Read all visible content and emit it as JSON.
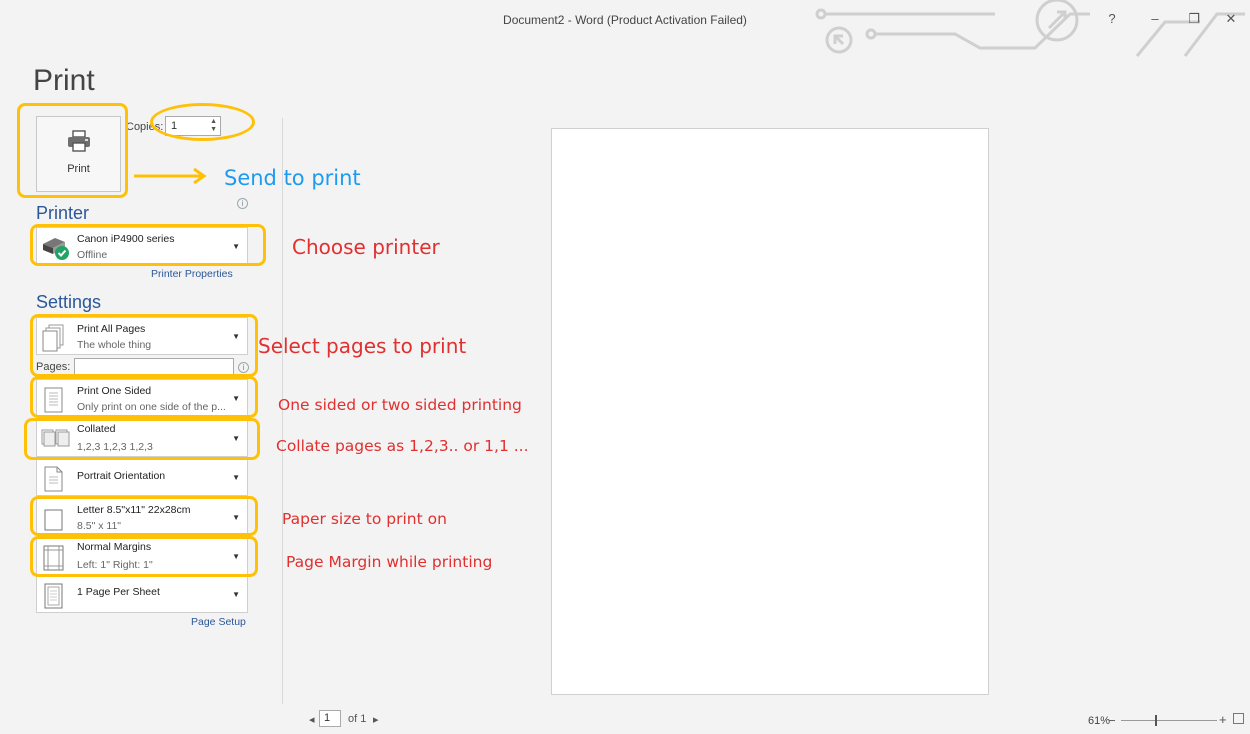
{
  "window": {
    "title": "Document2 - Word (Product Activation Failed)",
    "help": "?",
    "minimize": "–",
    "restore": "❐",
    "close": "✕"
  },
  "backstage": {
    "heading": "Print",
    "print_button_label": "Print",
    "copies_label": "Copies:",
    "copies_value": "1"
  },
  "printer": {
    "section_title": "Printer",
    "name": "Canon iP4900 series",
    "status": "Offline",
    "properties_link": "Printer Properties"
  },
  "settings": {
    "section_title": "Settings",
    "pages_label": "Pages:",
    "pages_value": "",
    "items": [
      {
        "title": "Print All Pages",
        "subtitle": "The whole thing",
        "icon": "pages-icon"
      },
      {
        "title": "Print One Sided",
        "subtitle": "Only print on one side of the p...",
        "icon": "one-sided-icon"
      },
      {
        "title": "Collated",
        "subtitle": "1,2,3    1,2,3    1,2,3",
        "icon": "collated-icon"
      },
      {
        "title": "Portrait Orientation",
        "subtitle": "",
        "icon": "portrait-icon"
      },
      {
        "title": "Letter 8.5\"x11\" 22x28cm",
        "subtitle": "8.5\" x 11\"",
        "icon": "paper-size-icon"
      },
      {
        "title": "Normal Margins",
        "subtitle": "Left:  1\"    Right:  1\"",
        "icon": "margins-icon"
      },
      {
        "title": "1 Page Per Sheet",
        "subtitle": "",
        "icon": "pages-per-sheet-icon"
      }
    ],
    "page_setup_link": "Page Setup"
  },
  "preview": {
    "page_current": "1",
    "page_total": "of 1",
    "zoom": "61%"
  },
  "annotations": {
    "send_to_print": "Send to print",
    "choose_printer": "Choose printer",
    "select_pages": "Select pages to print",
    "sided": "One sided or two sided printing",
    "collate": "Collate pages as 1,2,3.. or 1,1 ...",
    "paper_size": "Paper size to print on",
    "margin": "Page Margin while printing"
  },
  "colors": {
    "highlight": "#ffc107",
    "annotation_red": "#e03030",
    "annotation_blue": "#1e9bf0",
    "word_blue": "#2b579a"
  }
}
